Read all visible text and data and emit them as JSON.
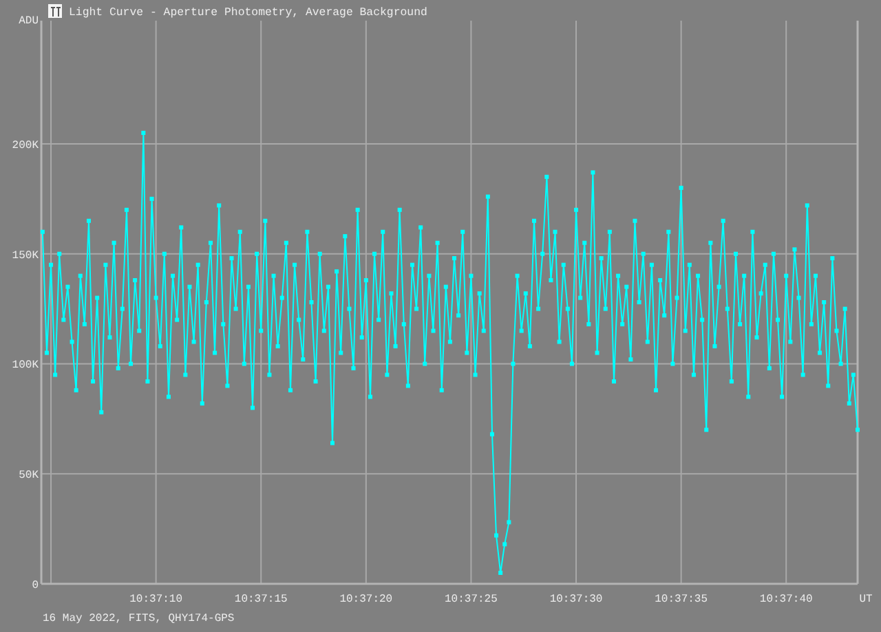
{
  "window": {
    "title": "Light Curve - Aperture Photometry, Average Background"
  },
  "chart": {
    "chart_data": {
      "type": "line",
      "grid": true,
      "xlabel": "UT",
      "ylabel": "ADU",
      "xlim": [
        38224.54,
        38263.4
      ],
      "ylim": [
        0,
        256000
      ],
      "xticks": [
        {
          "value": 38230,
          "label": "10:37:10"
        },
        {
          "value": 38235,
          "label": "10:37:15"
        },
        {
          "value": 38240,
          "label": "10:37:20"
        },
        {
          "value": 38245,
          "label": "10:37:25"
        },
        {
          "value": 38250,
          "label": "10:37:30"
        },
        {
          "value": 38255,
          "label": "10:37:35"
        },
        {
          "value": 38260,
          "label": "10:37:40"
        }
      ],
      "yticks": [
        {
          "value": 0,
          "label": "0"
        },
        {
          "value": 50000,
          "label": "50K"
        },
        {
          "value": 100000,
          "label": "100K"
        },
        {
          "value": 150000,
          "label": "150K"
        },
        {
          "value": 200000,
          "label": "200K"
        }
      ],
      "x": [
        38224.6,
        38224.8,
        38225.0,
        38225.2,
        38225.4,
        38225.6,
        38225.8,
        38226.0,
        38226.2,
        38226.4,
        38226.6,
        38226.8,
        38227.0,
        38227.2,
        38227.4,
        38227.6,
        38227.8,
        38228.0,
        38228.2,
        38228.4,
        38228.6,
        38228.8,
        38229.0,
        38229.2,
        38229.4,
        38229.6,
        38229.8,
        38230.0,
        38230.2,
        38230.4,
        38230.6,
        38230.8,
        38231.0,
        38231.2,
        38231.4,
        38231.6,
        38231.8,
        38232.0,
        38232.2,
        38232.4,
        38232.6,
        38232.8,
        38233.0,
        38233.2,
        38233.4,
        38233.6,
        38233.8,
        38234.0,
        38234.2,
        38234.4,
        38234.6,
        38234.8,
        38235.0,
        38235.2,
        38235.4,
        38235.6,
        38235.8,
        38236.0,
        38236.2,
        38236.4,
        38236.6,
        38236.8,
        38237.0,
        38237.2,
        38237.4,
        38237.6,
        38237.8,
        38238.0,
        38238.2,
        38238.4,
        38238.6,
        38238.8,
        38239.0,
        38239.2,
        38239.4,
        38239.6,
        38239.8,
        38240.0,
        38240.2,
        38240.4,
        38240.6,
        38240.8,
        38241.0,
        38241.2,
        38241.4,
        38241.6,
        38241.8,
        38242.0,
        38242.2,
        38242.4,
        38242.6,
        38242.8,
        38243.0,
        38243.2,
        38243.4,
        38243.6,
        38243.8,
        38244.0,
        38244.2,
        38244.4,
        38244.6,
        38244.8,
        38245.0,
        38245.2,
        38245.4,
        38245.6,
        38245.8,
        38246.0,
        38246.2,
        38246.4,
        38246.6,
        38246.8,
        38247.0,
        38247.2,
        38247.4,
        38247.6,
        38247.8,
        38248.0,
        38248.2,
        38248.4,
        38248.6,
        38248.8,
        38249.0,
        38249.2,
        38249.4,
        38249.6,
        38249.8,
        38250.0,
        38250.2,
        38250.4,
        38250.6,
        38250.8,
        38251.0,
        38251.2,
        38251.4,
        38251.6,
        38251.8,
        38252.0,
        38252.2,
        38252.4,
        38252.6,
        38252.8,
        38253.0,
        38253.2,
        38253.4,
        38253.6,
        38253.8,
        38254.0,
        38254.2,
        38254.4,
        38254.6,
        38254.8,
        38255.0,
        38255.2,
        38255.4,
        38255.6,
        38255.8,
        38256.0,
        38256.2,
        38256.4,
        38256.6,
        38256.8,
        38257.0,
        38257.2,
        38257.4,
        38257.6,
        38257.8,
        38258.0,
        38258.2,
        38258.4,
        38258.6,
        38258.8,
        38259.0,
        38259.2,
        38259.4,
        38259.6,
        38259.8,
        38260.0,
        38260.2,
        38260.4,
        38260.6,
        38260.8,
        38261.0,
        38261.2,
        38261.4,
        38261.6,
        38261.8,
        38262.0,
        38262.2,
        38262.4,
        38262.6,
        38262.8,
        38263.0,
        38263.2,
        38263.4
      ],
      "series": [
        {
          "color": "#00ffff",
          "marker": "square",
          "values": [
            160000,
            105000,
            145000,
            95000,
            150000,
            120000,
            135000,
            110000,
            88000,
            140000,
            118000,
            165000,
            92000,
            130000,
            78000,
            145000,
            112000,
            155000,
            98000,
            125000,
            170000,
            100000,
            138000,
            115000,
            205000,
            92000,
            175000,
            130000,
            108000,
            150000,
            85000,
            140000,
            120000,
            162000,
            95000,
            135000,
            110000,
            145000,
            82000,
            128000,
            155000,
            105000,
            172000,
            118000,
            90000,
            148000,
            125000,
            160000,
            100000,
            135000,
            80000,
            150000,
            115000,
            165000,
            95000,
            140000,
            108000,
            130000,
            155000,
            88000,
            145000,
            120000,
            102000,
            160000,
            128000,
            92000,
            150000,
            115000,
            135000,
            64000,
            142000,
            105000,
            158000,
            125000,
            98000,
            170000,
            112000,
            138000,
            85000,
            150000,
            120000,
            160000,
            95000,
            132000,
            108000,
            170000,
            118000,
            90000,
            145000,
            125000,
            162000,
            100000,
            140000,
            115000,
            155000,
            88000,
            135000,
            110000,
            148000,
            122000,
            160000,
            105000,
            140000,
            95000,
            132000,
            115000,
            176000,
            68000,
            22000,
            5000,
            18000,
            28000,
            100000,
            140000,
            115000,
            132000,
            108000,
            165000,
            125000,
            150000,
            185000,
            138000,
            160000,
            110000,
            145000,
            125000,
            100000,
            170000,
            130000,
            155000,
            118000,
            187000,
            105000,
            148000,
            125000,
            160000,
            92000,
            140000,
            118000,
            135000,
            102000,
            165000,
            128000,
            150000,
            110000,
            145000,
            88000,
            138000,
            122000,
            160000,
            100000,
            130000,
            180000,
            115000,
            145000,
            95000,
            140000,
            120000,
            70000,
            155000,
            108000,
            135000,
            165000,
            125000,
            92000,
            150000,
            118000,
            140000,
            85000,
            160000,
            112000,
            132000,
            145000,
            98000,
            150000,
            120000,
            85000,
            140000,
            110000,
            152000,
            130000,
            95000,
            172000,
            118000,
            140000,
            105000,
            128000,
            90000,
            148000,
            115000,
            100000,
            125000,
            82000,
            95000,
            70000
          ]
        }
      ]
    }
  },
  "footer": {
    "text": "16 May 2022, FITS, QHY174-GPS"
  }
}
